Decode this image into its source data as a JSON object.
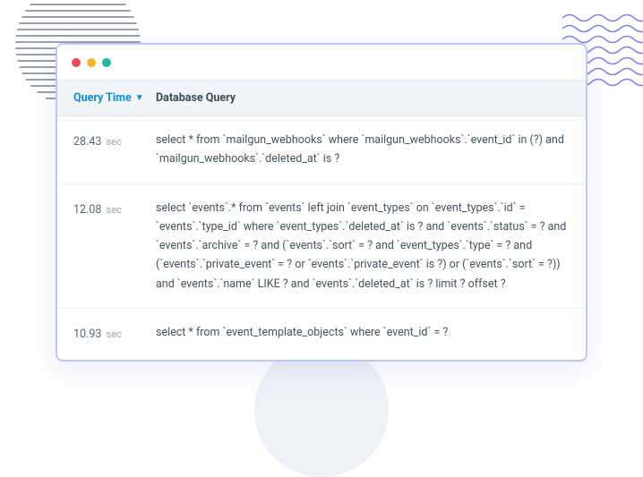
{
  "headers": {
    "query_time": "Query Time",
    "database_query": "Database Query"
  },
  "unit_label": "sec",
  "rows": [
    {
      "time": "28.43",
      "query": "select * from `mailgun_webhooks` where `mailgun_webhooks`.`event_id` in (?) and `mailgun_webhooks`.`deleted_at` is ?"
    },
    {
      "time": "12.08",
      "query": "select `events`.* from `events` left join `event_types` on `event_types`.`id` = `events`.`type_id` where `event_types`.`deleted_at` is ? and `events`.`status` = ? and `events`.`archive` = ? and (`events`.`sort` = ? and `event_types`.`type` = ? and (`events`.`private_event` = ? or `events`.`private_event` is ?) or (`events`.`sort` = ?)) and `events`.`name` LIKE ? and `events`.`deleted_at` is ? limit ? offset ?"
    },
    {
      "time": "10.93",
      "query": "select * from `event_template_objects` where `event_id` = ?"
    }
  ]
}
